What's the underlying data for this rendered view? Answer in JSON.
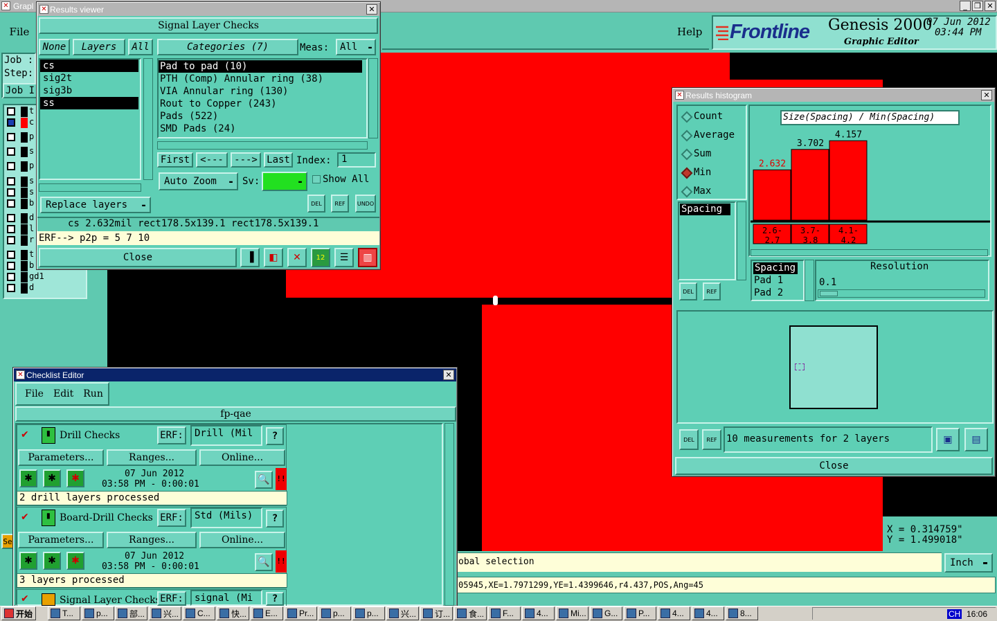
{
  "colors": {
    "bg_teal": "#5fc9b0",
    "red": "#ff0000",
    "black": "#000000",
    "title_active": "#0a246a",
    "yellow_status": "#fefed8"
  },
  "main": {
    "title_partial": "Grapl",
    "file_menu": "File",
    "help_menu": "Help",
    "brand_logo": "Frontline",
    "product": "Genesis 2000",
    "subtitle": "Graphic Editor",
    "date": "07 Jun 2012",
    "time": "03:44 PM",
    "left_labels": [
      "Job :",
      "Step:"
    ],
    "job_button": "Job I",
    "layer_rows": [
      "t",
      "c",
      "p",
      "s",
      "p",
      "s",
      "s",
      "b",
      "d",
      "l",
      "r",
      "t",
      "b",
      "gd1",
      "d"
    ],
    "se_label": "Se",
    "status_text": "obal selection",
    "units": "Inch",
    "coord_x": "X = 0.314759\"",
    "coord_y": "Y = 1.499018\"",
    "info_line": "05945,XE=1.7971299,YE=1.4399646,r4.437,POS,Ang=45"
  },
  "results_viewer": {
    "title": "Results viewer",
    "header": "Signal Layer Checks",
    "none_btn": "None",
    "layers_btn": "Layers",
    "all_btn": "All",
    "layers": [
      "cs",
      "sig2t",
      "sig3b",
      "ss"
    ],
    "categories_btn": "Categories (7)",
    "meas_label": "Meas:",
    "meas_value": "All",
    "categories": [
      "Pad to pad (10)",
      "PTH (Comp) Annular ring (38)",
      "VIA Annular ring (130)",
      "Rout to Copper (243)",
      "Pads (522)",
      "SMD Pads (24)"
    ],
    "first_btn": "First",
    "prev_btn": "<---",
    "next_btn": "--->",
    "last_btn": "Last",
    "index_label": "Index:",
    "index_value": "1",
    "replace_btn": "Replace layers",
    "auto_zoom_btn": "Auto Zoom",
    "sv_label": "Sv:",
    "show_all_label": "Show All",
    "del_label": "DEL",
    "ref_label": "REF",
    "undo_label": "UNDO",
    "info_line": "cs 2.632mil  rect178.5x139.1  rect178.5x139.1",
    "erf_line": "ERF--> p2p = 5 7 10",
    "close_btn": "Close"
  },
  "histogram": {
    "title": "Results histogram",
    "options": [
      "Count",
      "Average",
      "Sum",
      "Min",
      "Max"
    ],
    "selected_option": "Min",
    "chart_title": "Size(Spacing) / Min(Spacing)",
    "list_items": [
      "Spacing"
    ],
    "detail_items": [
      "Spacing",
      "Pad 1",
      "Pad 2"
    ],
    "resolution_label": "Resolution",
    "resolution_value": "0.1",
    "measurements_text": "10 measurements for 2 layers",
    "del_label": "DEL",
    "ref_label": "REF",
    "close_btn": "Close"
  },
  "chart_data": {
    "type": "bar",
    "title": "Size(Spacing) / Min(Spacing)",
    "categories": [
      "2.6-\n2.7",
      "3.7-\n3.8",
      "4.1-\n4.2"
    ],
    "category_labels": [
      "2.6-2.7",
      "3.7-3.8",
      "4.1-4.2"
    ],
    "values": [
      2.632,
      3.702,
      4.157
    ],
    "value_labels": [
      "2.632",
      "3.702",
      "4.157"
    ],
    "ylim": [
      0,
      5
    ],
    "bar_color": "#ff0000"
  },
  "checklist": {
    "title": "Checklist Editor",
    "menus": [
      "File",
      "Edit",
      "Run"
    ],
    "name": "fp-qae",
    "checks": [
      {
        "name": "Drill Checks",
        "erf_label": "ERF:",
        "erf_value": "Drill (Mil",
        "params": "Parameters...",
        "ranges": "Ranges...",
        "online": "Online...",
        "date": "07 Jun 2012",
        "time": "03:58 PM - 0:00:01",
        "status": "2 drill layers processed"
      },
      {
        "name": "Board-Drill Checks",
        "erf_label": "ERF:",
        "erf_value": "Std (Mils)",
        "params": "Parameters...",
        "ranges": "Ranges...",
        "online": "Online...",
        "date": "07 Jun 2012",
        "time": "03:58 PM - 0:00:01",
        "status": "3 layers processed"
      },
      {
        "name": "Signal Layer Checks",
        "erf_label": "ERF:",
        "erf_value": "signal (Mi"
      }
    ],
    "help_glyph": "?",
    "alert_glyph": "!!"
  },
  "taskbar": {
    "start": "开始",
    "items": [
      "T...",
      "p...",
      "部...",
      "兴...",
      "C...",
      "快...",
      "E...",
      "Pr...",
      "p...",
      "p...",
      "兴...",
      "订...",
      "食...",
      "F...",
      "4...",
      "Mi...",
      "G...",
      "P...",
      "4...",
      "4...",
      "8..."
    ],
    "clock": "16:06",
    "ime": "CH"
  }
}
